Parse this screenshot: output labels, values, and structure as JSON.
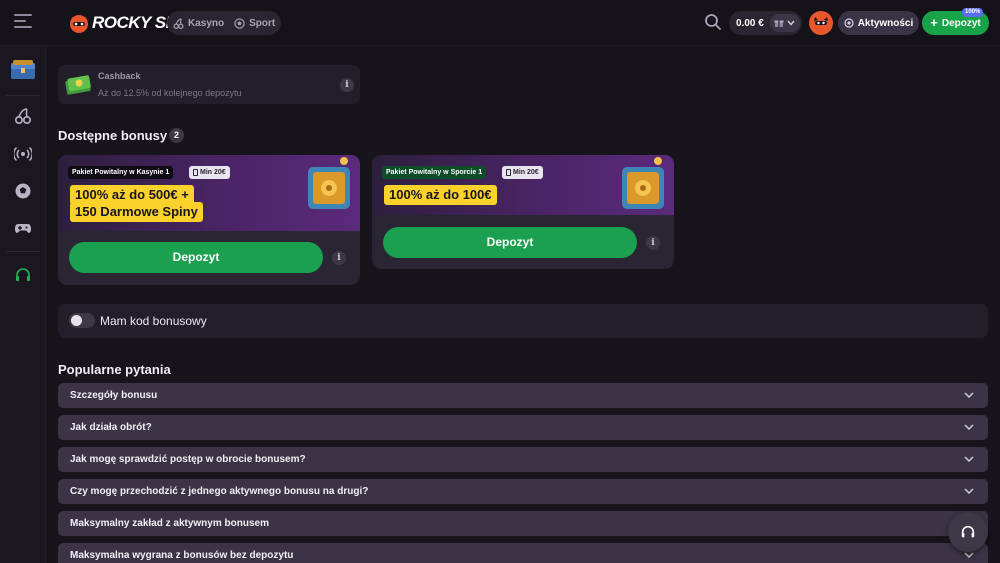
{
  "header": {
    "logo_text": "ROCKY SPIN",
    "tabs": [
      {
        "label": "Kasyno",
        "icon": "cherries-icon"
      },
      {
        "label": "Sport",
        "icon": "soccer-ball-icon"
      }
    ],
    "balance": "0.00 €",
    "activities_label": "Aktywności",
    "deposit_label": "Depozyt",
    "deposit_badge": "100%"
  },
  "sidebar": {
    "items": [
      {
        "name": "bonus-chest",
        "icon": "chest-icon"
      },
      {
        "name": "casino",
        "icon": "cherries-icon"
      },
      {
        "name": "live",
        "icon": "broadcast-icon"
      },
      {
        "name": "sport",
        "icon": "soccer-ball-icon"
      },
      {
        "name": "games",
        "icon": "gamepad-icon"
      },
      {
        "name": "support",
        "icon": "headset-icon"
      }
    ]
  },
  "cashback": {
    "title": "Cashback",
    "subtitle": "Aż do 12.5% od kolejnego depozytu",
    "info": "i"
  },
  "bonuses": {
    "title": "Dostępne bonusy",
    "count": "2",
    "cards": [
      {
        "tag": "Pakiet Powitalny w Kasynie 1",
        "min": "Min 20€",
        "headline_line1": "100% aż do 500€ +",
        "headline_line2": "150 Darmowe Spiny",
        "button": "Depozyt",
        "info": "i"
      },
      {
        "tag": "Pakiet Powitalny w Sporcie 1",
        "min": "Min 20€",
        "headline_line1": "100% aż do 100€",
        "button": "Depozyt",
        "info": "i"
      }
    ]
  },
  "promo": {
    "label": "Mam kod bonusowy",
    "enabled": false
  },
  "faq": {
    "title": "Popularne pytania",
    "items": [
      "Szczegóły bonusu",
      "Jak działa obrót?",
      "Jak mogę sprawdzić postęp w obrocie bonusem?",
      "Czy mogę przechodzić z jednego aktywnego bonusu na drugi?",
      "Maksymalny zakład z aktywnym bonusem",
      "Maksymalna wygrana z bonusów bez depozytu"
    ]
  },
  "colors": {
    "accent_green": "#1aa04e",
    "headline_yellow": "#fbd22b",
    "background": "#17141c"
  }
}
